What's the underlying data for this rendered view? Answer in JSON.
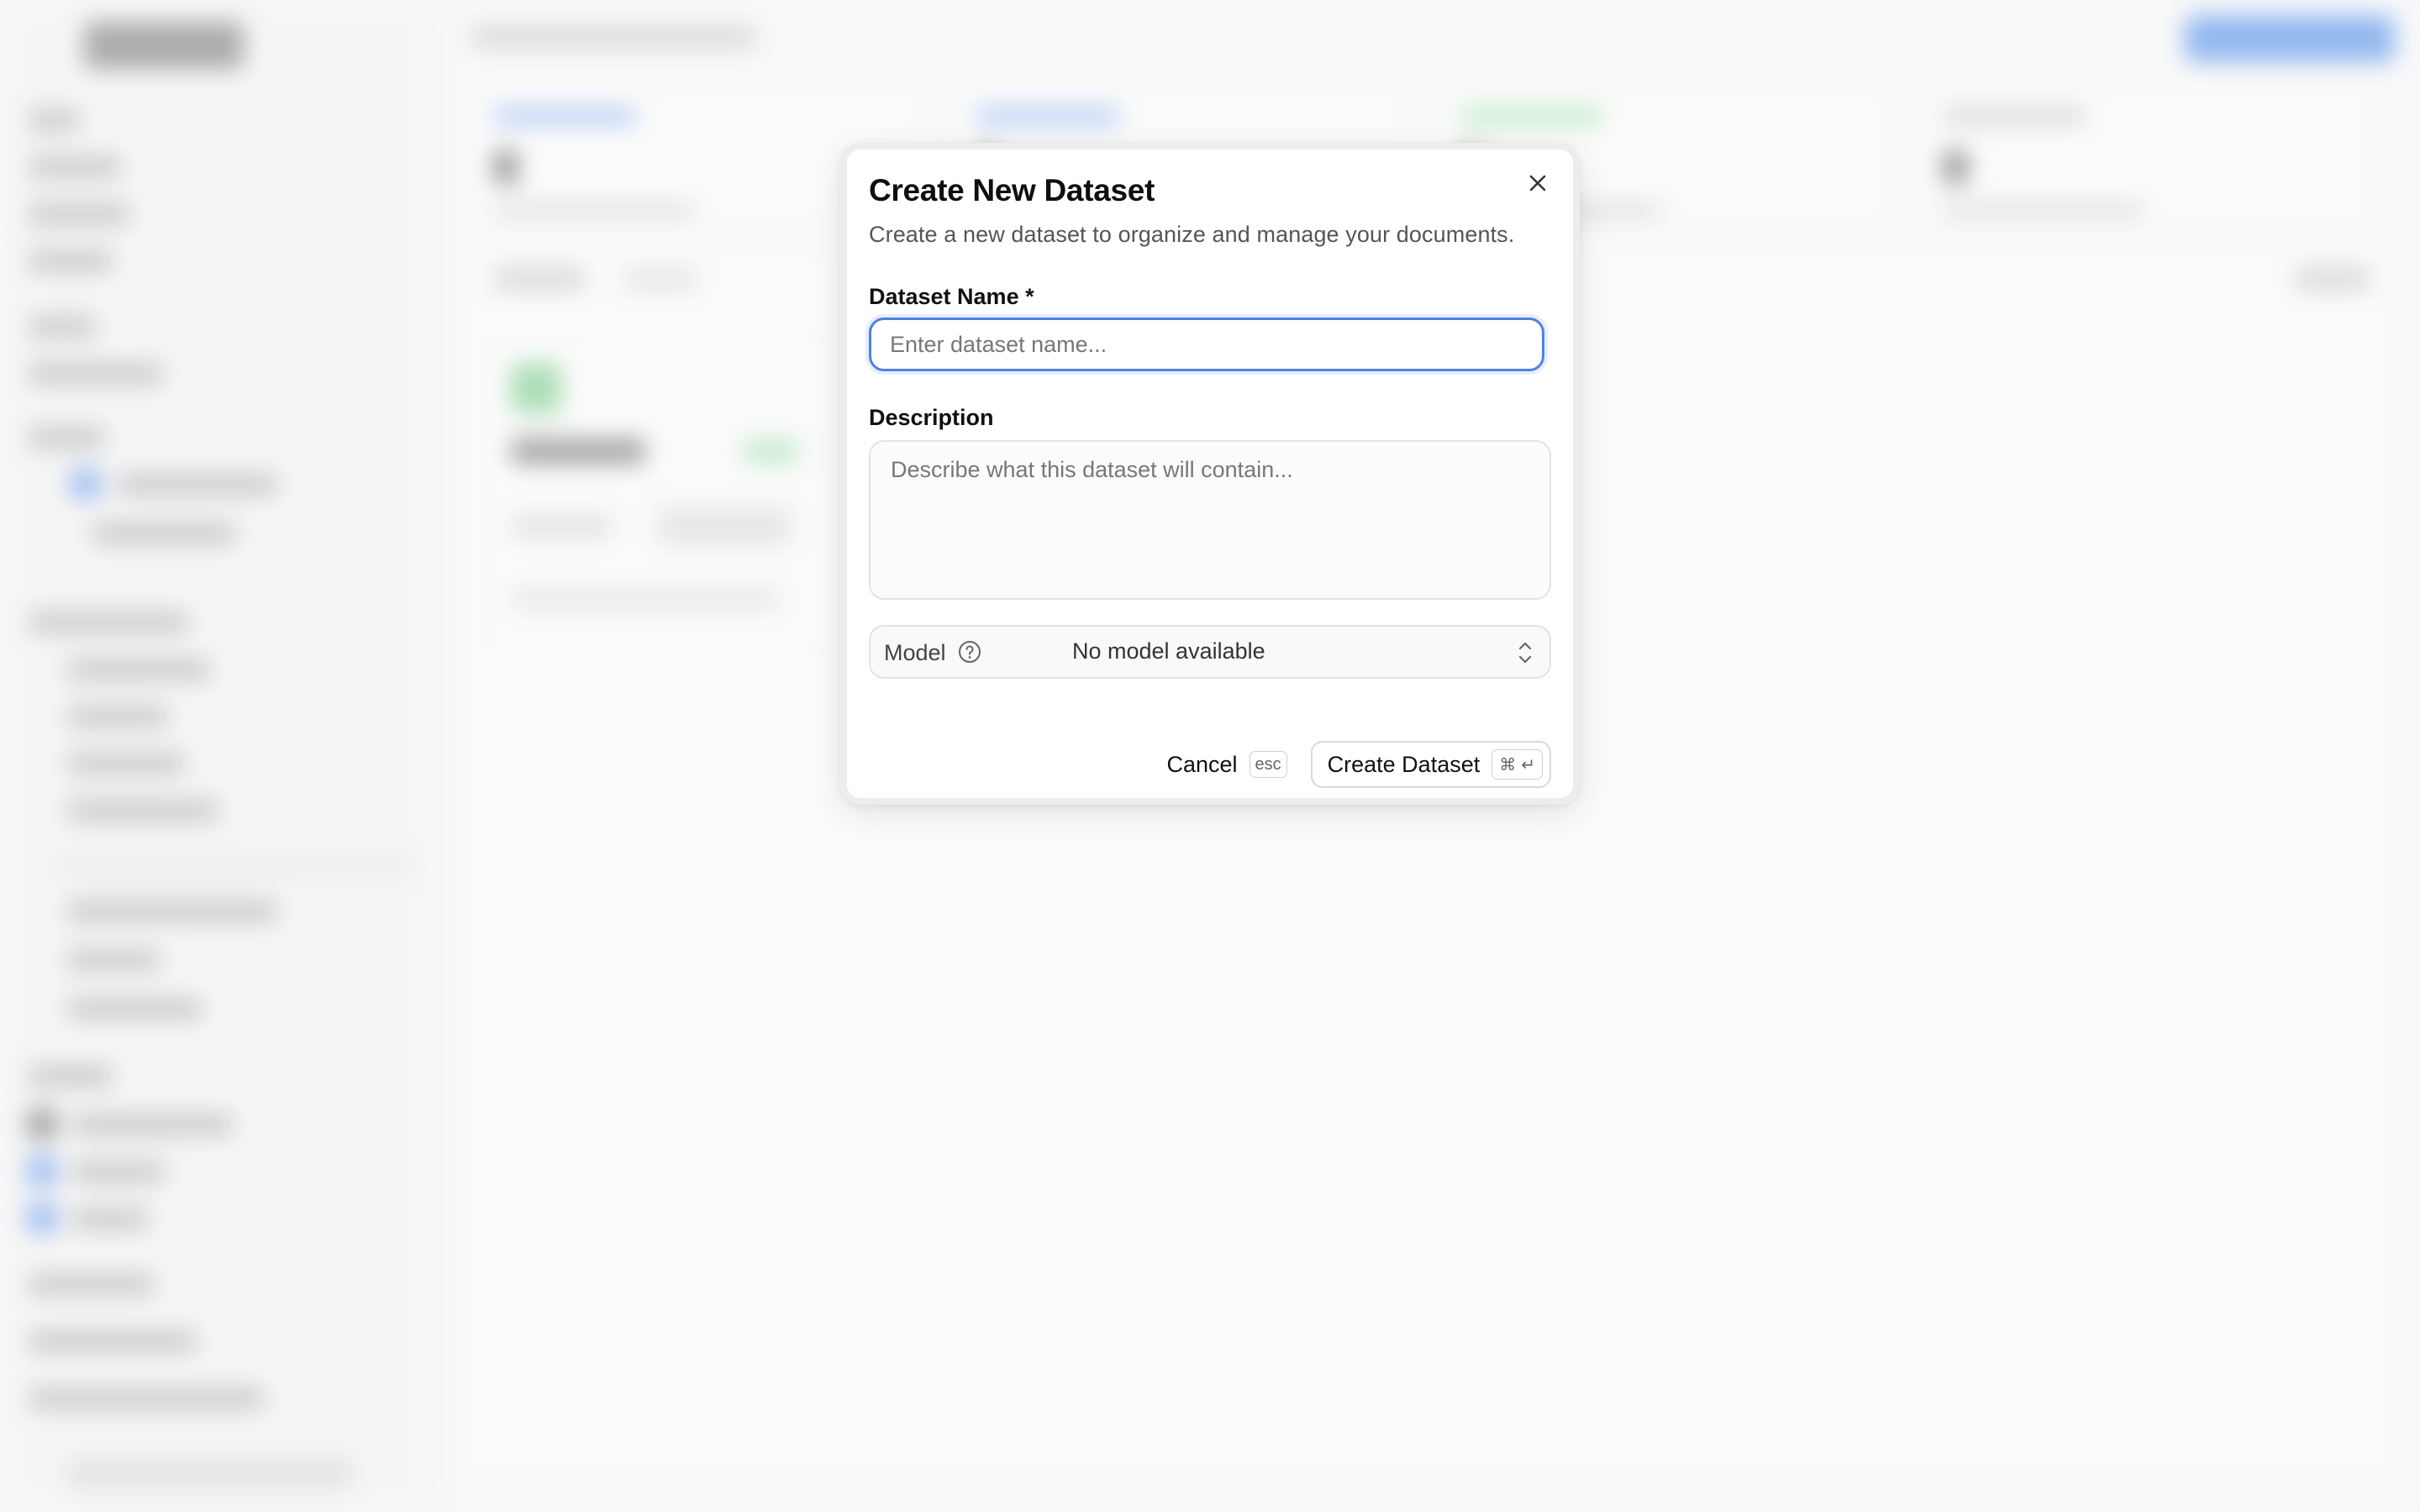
{
  "modal": {
    "title": "Create New Dataset",
    "subtitle": "Create a new dataset to organize and manage your documents.",
    "name_label": "Dataset Name *",
    "name_placeholder": "Enter dataset name...",
    "name_value": "",
    "description_label": "Description",
    "description_placeholder": "Describe what this dataset will contain...",
    "model_label": "Model",
    "model_value": "No model available",
    "cancel_label": "Cancel",
    "cancel_shortcut": "esc",
    "create_label": "Create Dataset",
    "create_shortcut_mod": "⌘",
    "create_shortcut_key": "↵"
  },
  "colors": {
    "accent": "#4f82e0",
    "primary_button_bg": "#1f6fe6",
    "success": "#56c06a"
  }
}
